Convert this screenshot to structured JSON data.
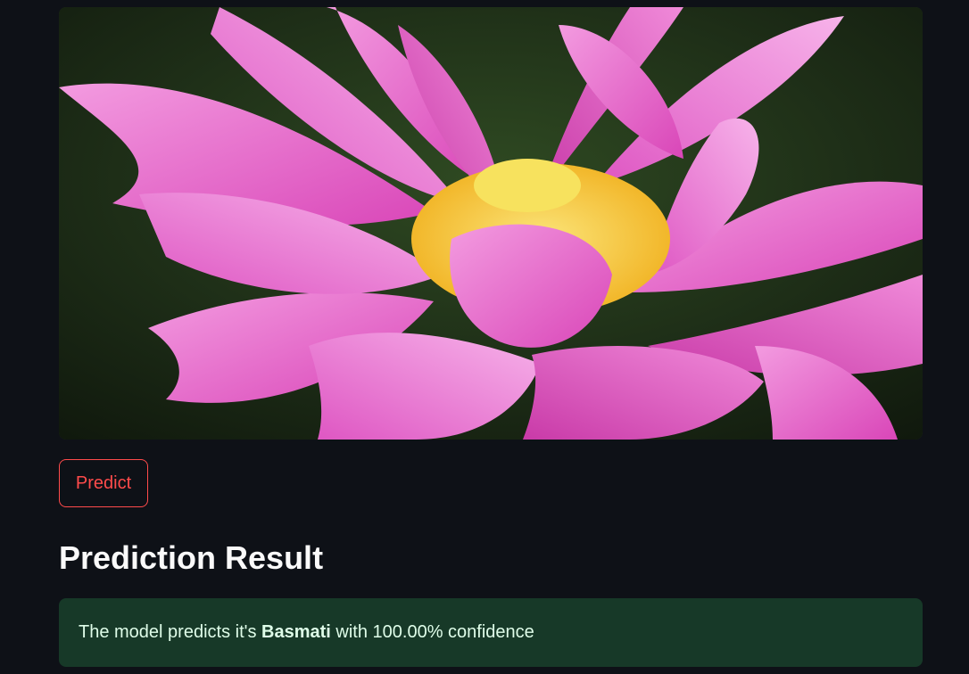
{
  "image": {
    "alt": "pink lotus flower",
    "colors": {
      "petal": "#e85bc9",
      "petal_light": "#f59ae2",
      "petal_dark": "#c23aa6",
      "center": "#f7d23a",
      "background": "#1d2a18"
    }
  },
  "predict_button": {
    "label": "Predict",
    "color": "#ff4b4b"
  },
  "result": {
    "heading": "Prediction Result",
    "prefix": "The model predicts it's ",
    "label": "Basmati",
    "middle": " with ",
    "confidence": "100.00%",
    "suffix": " confidence",
    "box_color": "#173928",
    "text_color": "#dffde9"
  }
}
